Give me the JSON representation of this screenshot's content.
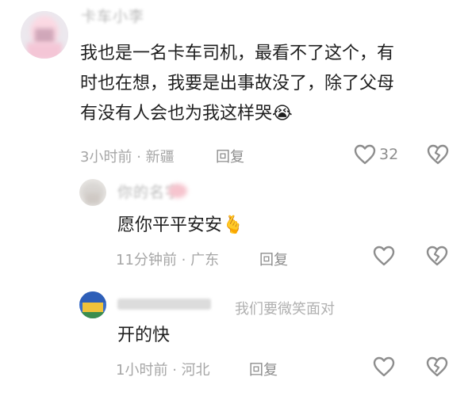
{
  "comments": [
    {
      "author": "卡车小李",
      "text_lines": [
        "我也是一名卡车司机，最看不了这个，有",
        "时也在想，我要是出事故没了，除了父母",
        "有没有人会也为我这样哭😭"
      ],
      "time": "3小时前",
      "location": "新疆",
      "reply_label": "回复",
      "like_count": "32"
    },
    {
      "author": "你的名字",
      "text": "愿你平平安安🫰",
      "time": "11分钟前",
      "location": "广东",
      "reply_label": "回复"
    },
    {
      "author": "我们要微笑面对",
      "text": "开的快",
      "time": "1小时前",
      "location": "河北",
      "reply_label": "回复"
    }
  ],
  "separator": "·",
  "icons": {
    "like": "heart-icon",
    "dislike": "broken-heart-icon"
  }
}
